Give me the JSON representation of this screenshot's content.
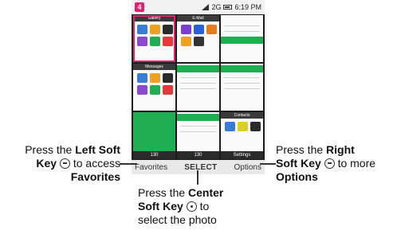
{
  "status": {
    "badge": "4",
    "network": "2G",
    "time": "6:19 PM"
  },
  "grid": {
    "tiles": [
      {
        "title": "Gallery"
      },
      {
        "title": "E-Mail"
      },
      {
        "title": ""
      },
      {
        "title": "Messages"
      },
      {
        "title": ""
      },
      {
        "title": ""
      },
      {
        "title": ""
      },
      {
        "title": ""
      },
      {
        "title": "Contacts"
      }
    ],
    "bottom_labels": [
      "130",
      "130",
      "Settings"
    ]
  },
  "softkeys": {
    "left": "Favorites",
    "center": "SELECT",
    "right": "Options"
  },
  "callouts": {
    "left": {
      "prefix": "Press the ",
      "bold1": "Left Soft",
      "bold2": "Key",
      "middle": " to access",
      "bold3": "Favorites"
    },
    "center": {
      "prefix": "Press the ",
      "bold1": "Center",
      "bold2": "Soft Key",
      "middle": " to",
      "tail": "select the photo"
    },
    "right": {
      "prefix": "Press the ",
      "bold1": "Right",
      "bold2": "Soft Key",
      "middle": " to more",
      "bold3": "Options"
    }
  },
  "colors": {
    "accent": "#e4206f",
    "green": "#1fae52"
  }
}
